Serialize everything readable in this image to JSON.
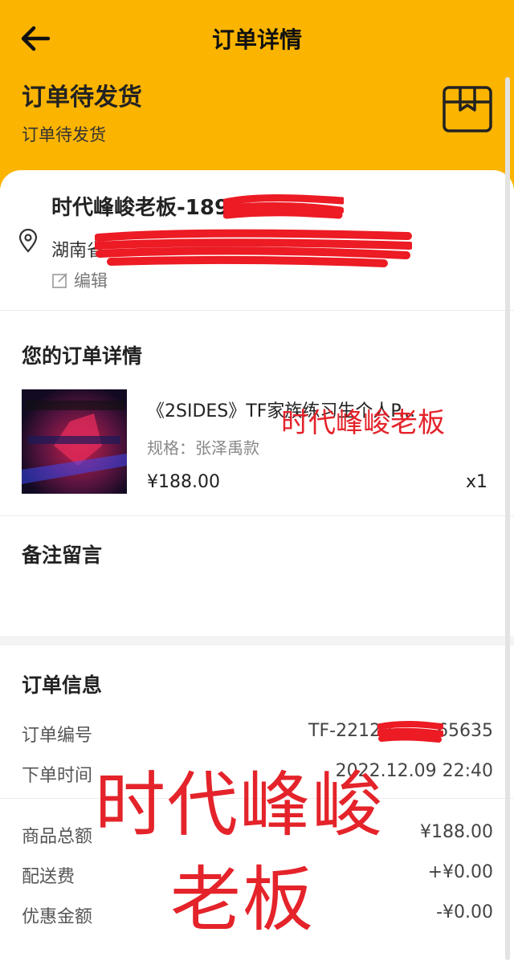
{
  "header": {
    "title": "订单详情",
    "status_title": "订单待发货",
    "status_subtitle": "订单待发货",
    "accent_color": "#fbb400"
  },
  "address": {
    "name_phone": "时代峰峻老板-189",
    "address": "湖南省",
    "edit_label": "编辑"
  },
  "order_details": {
    "section_title": "您的订单详情",
    "product": {
      "name": "《2SIDES》TF家族练习生个人P...",
      "spec": "规格：张泽禹款",
      "price": "¥188.00",
      "quantity": "x1"
    }
  },
  "remark": {
    "section_title": "备注留言"
  },
  "order_info": {
    "section_title": "订单信息",
    "rows": [
      {
        "label": "订单编号",
        "value": "TF-22120        65635"
      },
      {
        "label": "下单时间",
        "value": "2022.12.09 22:40"
      }
    ]
  },
  "amounts": [
    {
      "label": "商品总额",
      "value": "¥188.00"
    },
    {
      "label": "配送费",
      "value": "+¥0.00"
    },
    {
      "label": "优惠金额",
      "value": "-¥0.00"
    }
  ],
  "watermarks": {
    "small": "时代峰峻老板",
    "big_line1": "时代峰峻",
    "big_line2": "老板"
  },
  "icons": {
    "back": "arrow-left-icon",
    "package": "package-box-icon",
    "location": "location-pin-icon",
    "edit": "edit-icon"
  }
}
